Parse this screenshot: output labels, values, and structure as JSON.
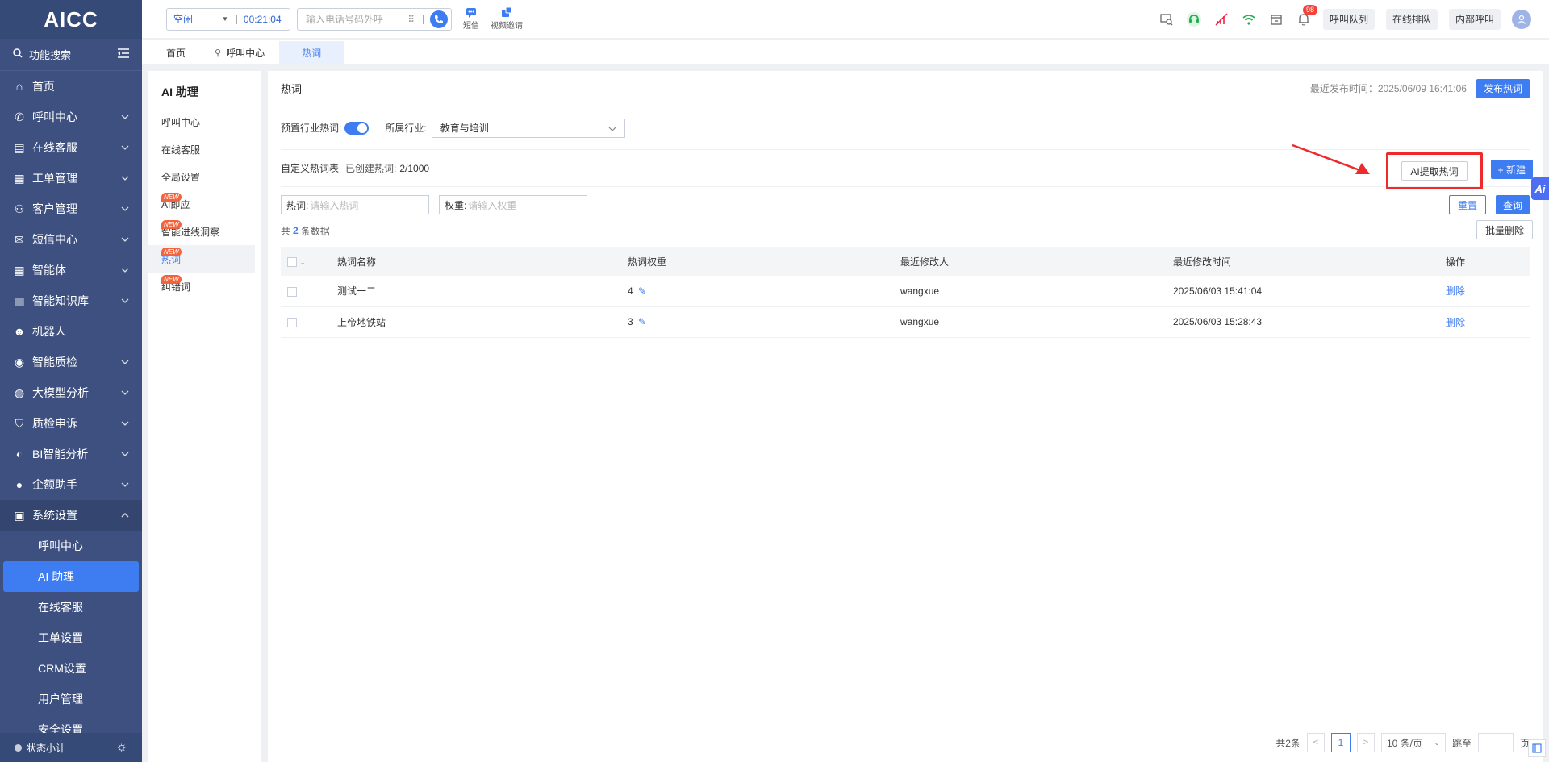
{
  "app": {
    "logo": "AICC"
  },
  "sidebar": {
    "search_label": "功能搜索",
    "items": [
      {
        "label": "首页",
        "icon": "home-icon",
        "has_children": false
      },
      {
        "label": "呼叫中心",
        "icon": "phone-icon",
        "has_children": true
      },
      {
        "label": "在线客服",
        "icon": "chat-icon",
        "has_children": true
      },
      {
        "label": "工单管理",
        "icon": "clipboard-icon",
        "has_children": true
      },
      {
        "label": "客户管理",
        "icon": "users-icon",
        "has_children": true
      },
      {
        "label": "短信中心",
        "icon": "mail-icon",
        "has_children": true
      },
      {
        "label": "智能体",
        "icon": "grid-icon",
        "has_children": true
      },
      {
        "label": "智能知识库",
        "icon": "library-icon",
        "has_children": true
      },
      {
        "label": "机器人",
        "icon": "robot-icon",
        "has_children": false
      },
      {
        "label": "智能质检",
        "icon": "pulse-icon",
        "has_children": true
      },
      {
        "label": "大模型分析",
        "icon": "bubble-icon",
        "has_children": true
      },
      {
        "label": "质检申诉",
        "icon": "shield-icon",
        "has_children": true
      },
      {
        "label": "BI智能分析",
        "icon": "pie-icon",
        "has_children": true
      },
      {
        "label": "企额助手",
        "icon": "chat-bubbles-icon",
        "has_children": true
      },
      {
        "label": "系统设置",
        "icon": "settings-grid-icon",
        "has_children": true,
        "expanded": true
      }
    ],
    "submenu": [
      "呼叫中心",
      "AI 助理",
      "在线客服",
      "工单设置",
      "CRM设置",
      "用户管理",
      "安全设置"
    ],
    "submenu_active": 1,
    "footer_label": "状态小计"
  },
  "topbar": {
    "status": "空闲",
    "timer": "00:21:04",
    "phone_placeholder": "输入电话号码外呼",
    "sms_label": "短信",
    "video_label": "视频邀请",
    "notification_count": "98",
    "buttons": [
      "呼叫队列",
      "在线排队",
      "内部呼叫"
    ]
  },
  "tabs": [
    {
      "label": "首页",
      "active": false
    },
    {
      "label": "呼叫中心",
      "active": false,
      "pinned": true
    },
    {
      "label": "热词",
      "active": true
    }
  ],
  "ai_panel": {
    "title": "AI 助理",
    "items": [
      {
        "label": "呼叫中心",
        "new": false
      },
      {
        "label": "在线客服",
        "new": false
      },
      {
        "label": "全局设置",
        "new": false
      },
      {
        "label": "AI即应",
        "new": true
      },
      {
        "label": "智能进线洞察",
        "new": true
      },
      {
        "label": "热词",
        "new": true,
        "active": true
      },
      {
        "label": "纠错词",
        "new": true
      }
    ],
    "new_tag": "NEW"
  },
  "main": {
    "title": "热词",
    "publish_time_label": "最近发布时间：2025/06/09 16:41:06",
    "publish_button": "发布热词",
    "preset_label": "预置行业热词:",
    "preset_enabled": true,
    "industry_label": "所属行业:",
    "industry_value": "教育与培训",
    "custom_title": "自定义热词表",
    "created_label": "已创建热词:",
    "created_count": "2/1000",
    "ai_extract_button": "AI提取热词",
    "new_button": "+ 新建",
    "filter": {
      "hotword_label": "热词:",
      "hotword_placeholder": "请输入热词",
      "weight_label": "权重:",
      "weight_placeholder": "请输入权重",
      "reset": "重置",
      "query": "查询"
    },
    "total_prefix": "共",
    "total_count": "2",
    "total_suffix": "条数据",
    "batch_delete": "批量删除",
    "table": {
      "headers": [
        "热词名称",
        "热词权重",
        "最近修改人",
        "最近修改时间",
        "操作"
      ],
      "rows": [
        {
          "name": "测试一二",
          "weight": "4",
          "modifier": "wangxue",
          "time": "2025/06/03 15:41:04",
          "action": "删除"
        },
        {
          "name": "上帝地铁站",
          "weight": "3",
          "modifier": "wangxue",
          "time": "2025/06/03 15:28:43",
          "action": "删除"
        }
      ]
    },
    "pagination": {
      "total": "共2条",
      "current": "1",
      "page_size": "10 条/页",
      "jump_label": "跳至",
      "jump_suffix": "页"
    }
  },
  "colors": {
    "primary": "#3e7cf1",
    "sidebar": "#3d5080",
    "highlight": "#ee2a2a"
  }
}
